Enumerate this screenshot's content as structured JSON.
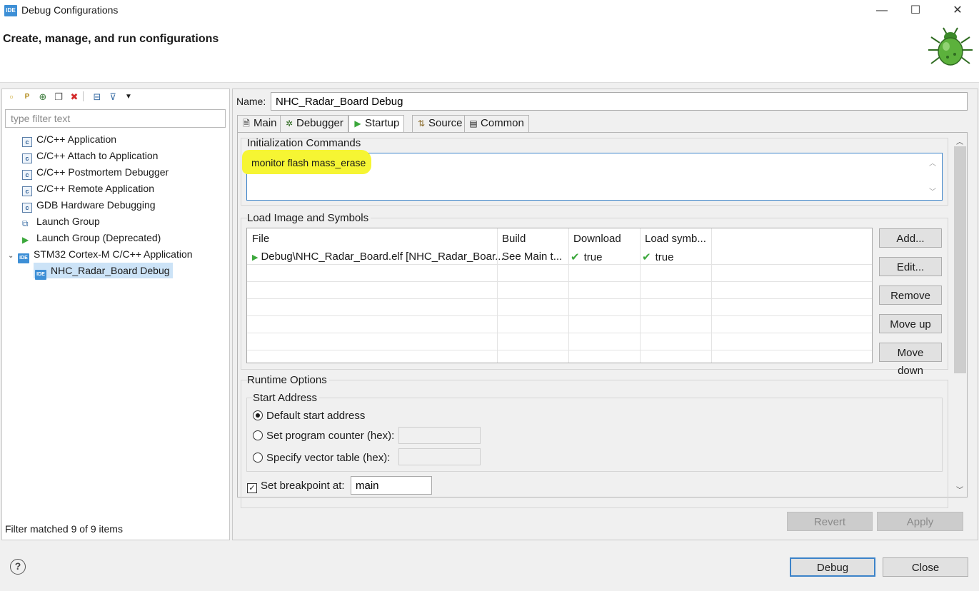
{
  "window": {
    "icon_text": "IDE",
    "title": "Debug Configurations",
    "minimize": "—",
    "maximize": "☐",
    "close": "✕"
  },
  "header": {
    "title": "Create, manage, and run configurations",
    "bug_icon": "debug-bug-icon"
  },
  "left": {
    "filter_placeholder": "type filter text",
    "toolbar_icons": [
      "new-config-icon",
      "new-prototype-icon",
      "export-icon",
      "duplicate-icon",
      "delete-icon",
      "collapse-all-icon",
      "filter-icon",
      "view-menu-icon"
    ],
    "tree": [
      {
        "label": "C/C++ Application",
        "icon": "c-icon"
      },
      {
        "label": "C/C++ Attach to Application",
        "icon": "c-icon"
      },
      {
        "label": "C/C++ Postmortem Debugger",
        "icon": "c-icon"
      },
      {
        "label": "C/C++ Remote Application",
        "icon": "c-icon"
      },
      {
        "label": "GDB Hardware Debugging",
        "icon": "c-icon"
      },
      {
        "label": "Launch Group",
        "icon": "launch-group-icon"
      },
      {
        "label": "Launch Group (Deprecated)",
        "icon": "launch-arrow-icon"
      },
      {
        "label": "STM32 Cortex-M C/C++ Application",
        "icon": "ide-icon"
      },
      {
        "label": "NHC_Radar_Board Debug",
        "icon": "ide-icon"
      }
    ],
    "status": "Filter matched 9 of 9 items"
  },
  "config": {
    "name_label": "Name:",
    "name_value": "NHC_Radar_Board Debug",
    "tabs": [
      "Main",
      "Debugger",
      "Startup",
      "Source",
      "Common"
    ],
    "active_tab": "Startup",
    "init": {
      "title": "Initialization Commands",
      "value": "monitor flash mass_erase"
    },
    "load": {
      "title": "Load Image and Symbols",
      "columns": [
        "File",
        "Build",
        "Download",
        "Load symb..."
      ],
      "rows": [
        {
          "file": "Debug\\NHC_Radar_Board.elf [NHC_Radar_Boar...",
          "build": "See Main t...",
          "download": "true",
          "load_symbols": "true"
        }
      ],
      "buttons": [
        "Add...",
        "Edit...",
        "Remove",
        "Move up",
        "Move down"
      ]
    },
    "runtime": {
      "title": "Runtime Options",
      "start_title": "Start Address",
      "options": [
        "Default start address",
        "Set program counter (hex):",
        "Specify vector table (hex):"
      ],
      "selected": "Default start address",
      "breakpoint_label": "Set breakpoint at:",
      "breakpoint_checked": true,
      "breakpoint_value": "main"
    },
    "revert": "Revert",
    "apply": "Apply"
  },
  "footer": {
    "help": "?",
    "debug": "Debug",
    "close": "Close"
  },
  "colors": {
    "highlight": "#f6f533",
    "accent": "#3c83c9",
    "check": "#3ca83c"
  }
}
